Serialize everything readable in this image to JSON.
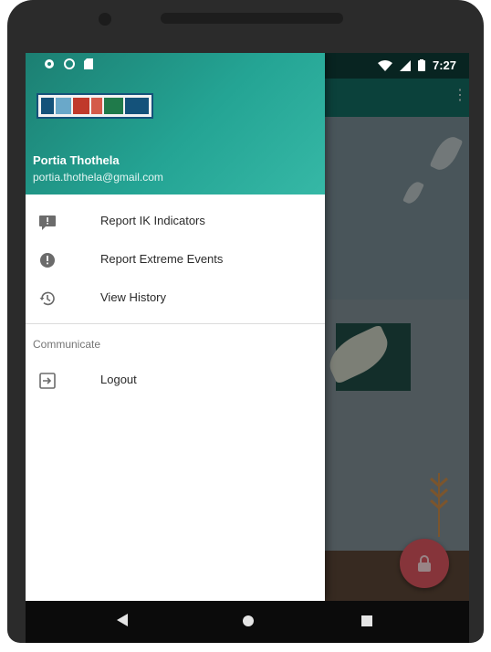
{
  "status_bar": {
    "time": "7:27",
    "left_icons": [
      "settings-icon",
      "circle-icon",
      "sd-card-icon"
    ],
    "right_icons": [
      "wifi-icon",
      "signal-icon",
      "battery-icon"
    ]
  },
  "app": {
    "overflow_menu_icon": "more-vert-icon",
    "fab_icon": "lock-icon",
    "accent_color": "#d8545e",
    "toolbar_color": "#13695f"
  },
  "drawer": {
    "header_color": "#24a494",
    "logo_icon": "itik-logo",
    "user_name": "Portia Thothela",
    "user_email": "portia.thothela@gmail.com",
    "items": [
      {
        "label": "Report IK Indicators",
        "icon": "report-icon"
      },
      {
        "label": "Report Extreme Events",
        "icon": "alert-circle-icon"
      },
      {
        "label": "View History",
        "icon": "history-icon"
      }
    ],
    "section_title": "Communicate",
    "section_items": [
      {
        "label": "Logout",
        "icon": "logout-icon"
      }
    ]
  },
  "nav_bar": {
    "icons": [
      "back-icon",
      "home-icon",
      "recents-icon"
    ]
  }
}
